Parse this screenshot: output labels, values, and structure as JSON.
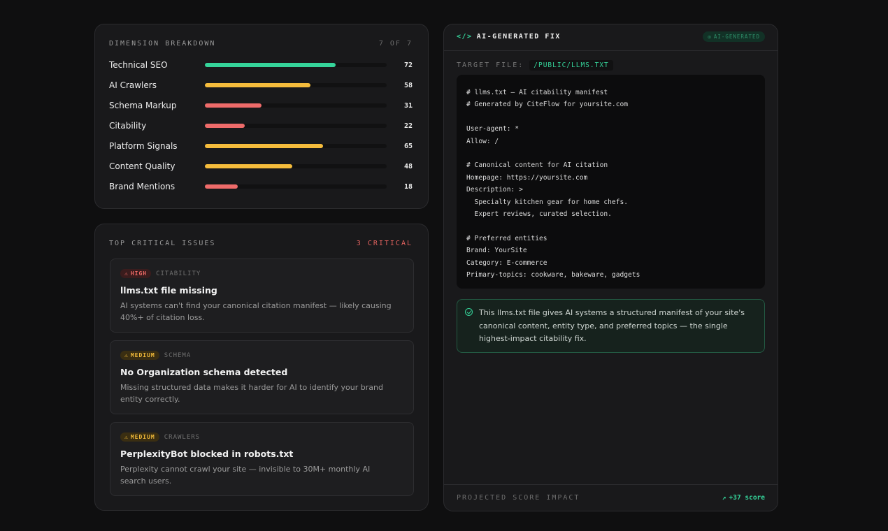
{
  "dimensions": {
    "title": "DIMENSION BREAKDOWN",
    "count": "7 OF 7",
    "items": [
      {
        "label": "Technical SEO",
        "value": "72",
        "level": 0.72,
        "color": "#35d49a"
      },
      {
        "label": "AI Crawlers",
        "value": "58",
        "level": 0.58,
        "color": "#f5bc3c"
      },
      {
        "label": "Schema Markup",
        "value": "31",
        "level": 0.31,
        "color": "#ee6b6a"
      },
      {
        "label": "Citability",
        "value": "22",
        "level": 0.22,
        "color": "#ee6b6a"
      },
      {
        "label": "Platform Signals",
        "value": "65",
        "level": 0.65,
        "color": "#f5bc3c"
      },
      {
        "label": "Content Quality",
        "value": "48",
        "level": 0.48,
        "color": "#f5bc3c"
      },
      {
        "label": "Brand Mentions",
        "value": "18",
        "level": 0.18,
        "color": "#ee6b6a"
      }
    ]
  },
  "issues": {
    "title": "TOP CRITICAL ISSUES",
    "critical_count": "3 CRITICAL",
    "items": [
      {
        "severity": "HIGH",
        "category": "CITABILITY",
        "title": "llms.txt file missing",
        "desc": "AI systems can't find your canonical citation manifest — likely causing 40%+ of citation loss."
      },
      {
        "severity": "MEDIUM",
        "category": "SCHEMA",
        "title": "No Organization schema detected",
        "desc": "Missing structured data makes it harder for AI to identify your brand entity correctly."
      },
      {
        "severity": "MEDIUM",
        "category": "CRAWLERS",
        "title": "PerplexityBot blocked in robots.txt",
        "desc": "Perplexity cannot crawl your site — invisible to 30M+ monthly AI search users."
      }
    ]
  },
  "fix": {
    "title": "AI-GENERATED FIX",
    "badge": "AI-GENERATED",
    "target_label": "TARGET FILE:",
    "target_path": "/PUBLIC/LLMS.TXT",
    "code": "# llms.txt — AI citability manifest\n# Generated by CiteFlow for yoursite.com\n\nUser-agent: *\nAllow: /\n\n# Canonical content for AI citation\nHomepage: https://yoursite.com\nDescription: >\n  Specialty kitchen gear for home chefs.\n  Expert reviews, curated selection.\n\n# Preferred entities\nBrand: YourSite\nCategory: E-commerce\nPrimary-topics: cookware, bakeware, gadgets",
    "note": "This llms.txt file gives AI systems a structured manifest of your site's canonical content, entity type, and preferred topics — the single highest-impact citability fix.",
    "footer_label": "PROJECTED SCORE IMPACT",
    "score_arrow": "↗",
    "score": "+37 score"
  },
  "icons": {
    "code": "code-icon",
    "warning": "warning-icon",
    "check": "check-circle-icon",
    "sparkle": "sparkle-icon",
    "trend": "trend-up-icon"
  }
}
